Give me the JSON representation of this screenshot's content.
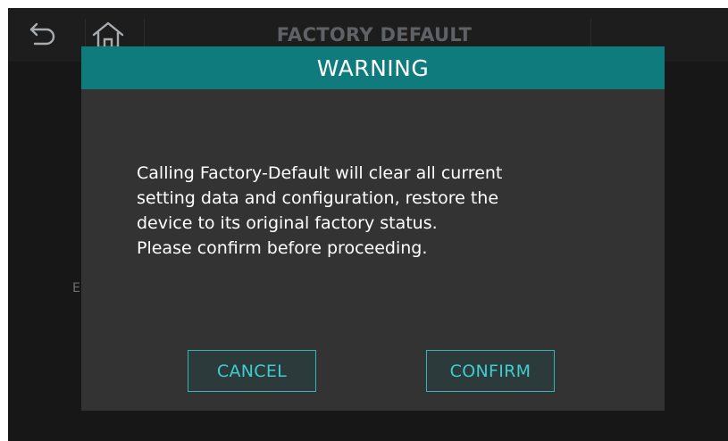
{
  "header": {
    "title": "FACTORY DEFAULT",
    "back_icon": "back-arrow-icon",
    "home_icon": "home-icon"
  },
  "background": {
    "peek_text": "E"
  },
  "dialog": {
    "title": "WARNING",
    "message_lines": [
      "Calling Factory-Default will clear all current",
      "setting data and configuration, restore the",
      "device to its original factory status.",
      "Please confirm before proceeding."
    ],
    "cancel_label": "CANCEL",
    "confirm_label": "CONFIRM"
  },
  "colors": {
    "header_teal": "#0f7b7c",
    "button_border": "#2fb7b5",
    "button_text": "#3dcfcc",
    "dialog_bg": "#333333",
    "screen_bg": "#161616"
  }
}
